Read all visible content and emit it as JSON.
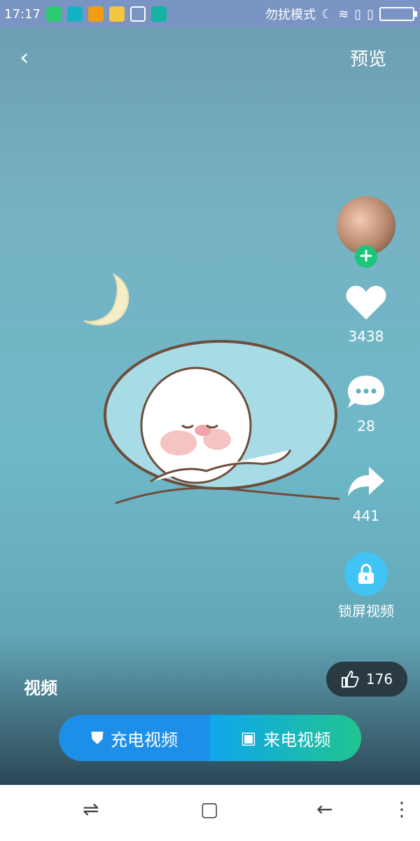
{
  "status": {
    "time": "17:17",
    "dnd": "勿扰模式"
  },
  "header": {
    "back_icon": "chevron-left",
    "preview_label": "预览"
  },
  "rail": {
    "like_count": "3438",
    "comment_count": "28",
    "share_count": "441",
    "lock_video_label": "锁屏视频"
  },
  "footer": {
    "video_label": "视频",
    "thumb_count": "176",
    "charge_button": "充电视频",
    "call_button": "来电视频"
  },
  "colors": {
    "accent": "#1e8fe8",
    "success": "#1ec47a"
  }
}
